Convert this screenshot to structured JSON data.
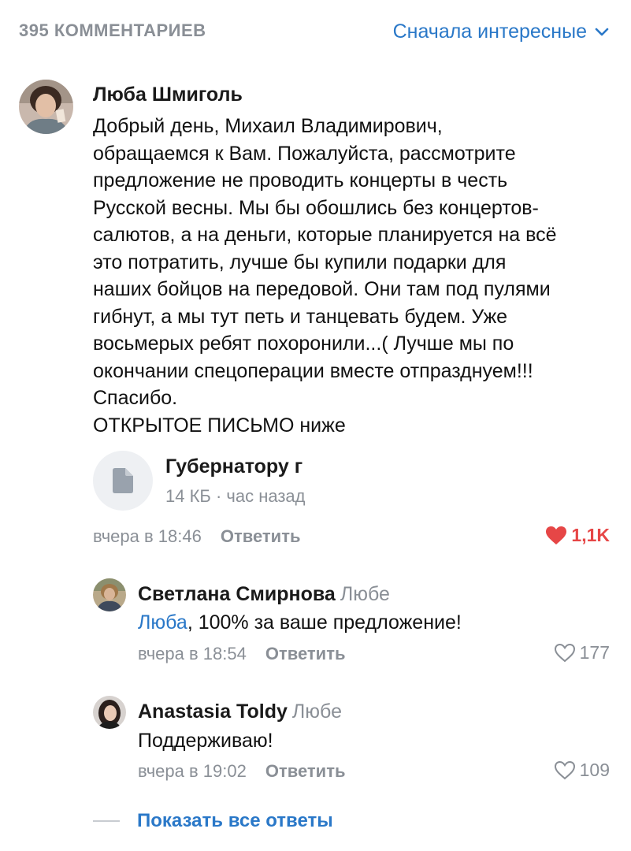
{
  "header": {
    "comments_count": "395 КОММЕНТАРИЕВ",
    "sort_label": "Сначала интересные"
  },
  "main_comment": {
    "author": "Люба Шмиголь",
    "text_lines": [
      "Добрый день, Михаил Владимирович,",
      "обращаемся к Вам. Пожалуйста, рассмотрите",
      "предложение не проводить концерты в честь",
      "Русской весны. Мы бы обошлись без концертов-",
      "салютов, а на деньги, которые планируется на всё",
      "это потратить, лучше бы купили подарки для",
      "наших бойцов на передовой. Они там под пулями",
      "гибнут, а мы тут петь и танцевать будем. Уже",
      "восьмерых ребят похоронили...( Лучше мы по",
      "окончании спецоперации вместе отпразднуем!!!",
      "Спасибо.",
      "ОТКРЫТОЕ ПИСЬМО ниже"
    ],
    "attachment": {
      "name": "Губернатору г",
      "meta": "14 КБ · час назад",
      "icon": "document-icon"
    },
    "time": "вчера в 18:46",
    "reply_label": "Ответить",
    "likes": "1,1K",
    "liked": true
  },
  "replies": [
    {
      "author": "Светлана Смирнова",
      "to": "Любе",
      "mention": "Люба",
      "text": ", 100% за ваше предложение!",
      "time": "вчера в 18:54",
      "reply_label": "Ответить",
      "likes": "177"
    },
    {
      "author": "Anastasia Toldy",
      "to": "Любе",
      "text": "Поддерживаю!",
      "time": "вчера в 19:02",
      "reply_label": "Ответить",
      "likes": "109"
    }
  ],
  "show_all_label": "Показать все ответы",
  "colors": {
    "accent": "#2a78c8",
    "muted": "#8a8f96",
    "like_active": "#e64646"
  }
}
